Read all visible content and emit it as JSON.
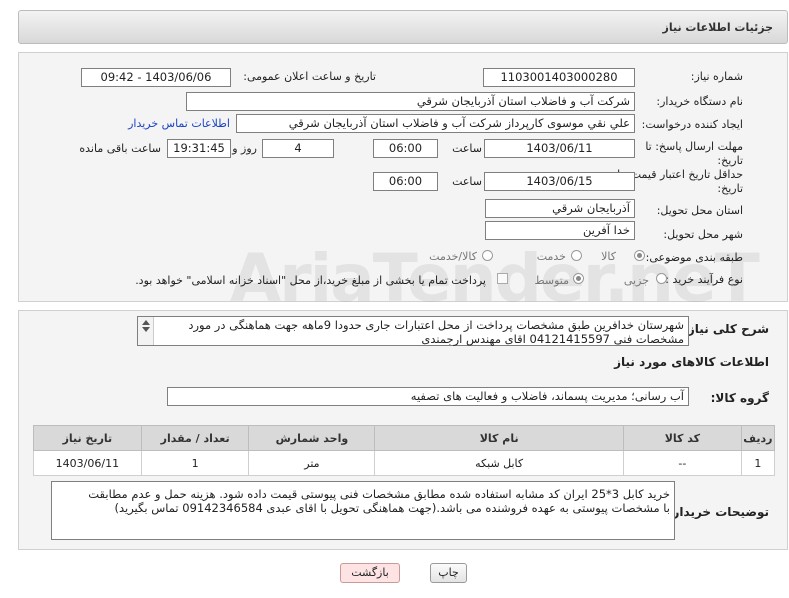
{
  "header": {
    "title": "جزئیات اطلاعات نیاز"
  },
  "form": {
    "need_number_label": "شماره نیاز:",
    "need_number": "1103001403000280",
    "announce_label": "تاریخ و ساعت اعلان عمومی:",
    "announce_value": "1403/06/06 - 09:42",
    "buyer_org_label": "نام دستگاه خریدار:",
    "buyer_org": "شرکت آب و فاضلاب استان آذربایجان شرقي",
    "requester_label": "ایجاد کننده درخواست:",
    "requester": "علي نقي موسوی کارپرداز شرکت آب و فاضلاب استان آذربایجان شرقي",
    "buyer_contact_link": "اطلاعات تماس خریدار",
    "reply_deadline_label_1": "مهلت ارسال پاسخ: تا",
    "reply_deadline_label_2": "تاریخ:",
    "reply_date": "1403/06/11",
    "time_label": "ساعت",
    "reply_time": "06:00",
    "days_value": "4",
    "days_label": "روز و",
    "remaining_time": "19:31:45",
    "remaining_label": "ساعت باقی مانده",
    "price_validity_label_1": "حداقل تاریخ اعتبار قیمت: تا",
    "price_validity_label_2": "تاریخ:",
    "price_date": "1403/06/15",
    "price_time": "06:00",
    "province_label": "استان محل تحویل:",
    "province": "آذربایجان شرقي",
    "city_label": "شهر محل تحویل:",
    "city": "خدا آفرين",
    "category_label": "طبقه بندی موضوعی:",
    "category_goods": "کالا",
    "category_service": "خدمت",
    "category_goods_service": "کالا/خدمت",
    "process_label": "نوع فرآیند خرید :",
    "process_partial": "جزیی",
    "process_medium": "متوسط",
    "payment_note": "پرداخت تمام یا بخشی از مبلغ خرید،از محل \"اسناد خزانه اسلامی\" خواهد بود."
  },
  "details": {
    "summary_label": "شرح کلی نیاز:",
    "summary_line1": "شهرستان خدافرین   طبق مشخصات پرداخت از محل اعتبارات جاری حدودا 9ماهه جهت هماهنگی در مورد",
    "summary_line2": "مشخصات فنی 04121415597 اقای مهندس ارجمندی",
    "goods_info_title": "اطلاعات کالاهای مورد نیاز",
    "goods_group_label": "گروه کالا:",
    "goods_group": "آب رسانی؛ مدیریت پسماند، فاضلاب و فعالیت های تصفیه",
    "table_headers": [
      "ردیف",
      "کد کالا",
      "نام کالا",
      "واحد شمارش",
      "تعداد / مقدار",
      "تاریخ نیاز"
    ],
    "table_rows": [
      {
        "row": "1",
        "code": "--",
        "name": "کابل شبکه",
        "unit": "متر",
        "qty": "1",
        "date": "1403/06/11"
      }
    ],
    "buyer_notes_label": "توضیحات خریدار:",
    "buyer_notes_line1": "خرید کابل 3*25   ایران کد مشابه استفاده شده مطابق مشخصات فنی پیوستی قیمت داده شود. هزینه حمل و عدم مطابقت",
    "buyer_notes_line2": "با مشخصات پیوستی به عهده فروشنده می باشد.(جهت هماهنگی تحویل با اقای عبدی 09142346584 تماس بگیرید)"
  },
  "buttons": {
    "print": "چاپ",
    "back": "بازگشت"
  },
  "watermark": "AriaTender.neT",
  "colors": {
    "link": "#1a44c4",
    "back_button_bg": "#fde3e3"
  }
}
